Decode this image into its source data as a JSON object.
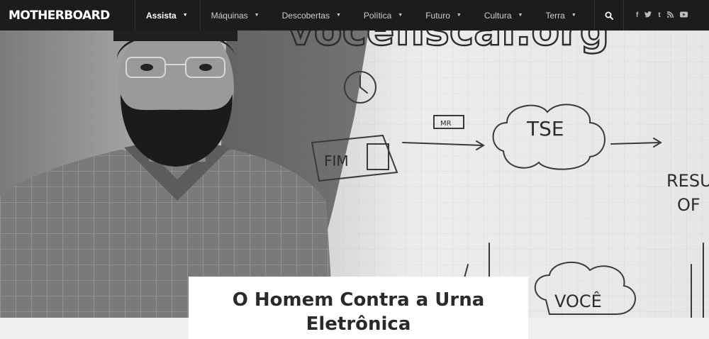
{
  "header": {
    "logo": "MOTHERBOARD",
    "nav": [
      {
        "label": "Assista",
        "active": true
      },
      {
        "label": "Máquinas"
      },
      {
        "label": "Descobertas"
      },
      {
        "label": "Política"
      },
      {
        "label": "Futuro"
      },
      {
        "label": "Cultura"
      },
      {
        "label": "Terra"
      }
    ],
    "caret": "▼",
    "icons": {
      "search": "search-icon",
      "social": [
        {
          "name": "facebook-icon",
          "glyph": "f"
        },
        {
          "name": "twitter-icon",
          "glyph": "t"
        },
        {
          "name": "tumblr-icon",
          "glyph": "t"
        },
        {
          "name": "rss-icon",
          "glyph": "rss"
        },
        {
          "name": "youtube-icon",
          "glyph": "▶"
        }
      ]
    }
  },
  "hero": {
    "whiteboard": {
      "url_text": "vocefiscal.org",
      "fim_label": "FIM",
      "chip_label": "MR",
      "tse_label": "TSE",
      "result_line1": "RESU",
      "result_line2": "OF",
      "voce_label": "VOCÊ"
    }
  },
  "article": {
    "title": "O Homem Contra a Urna Eletrônica"
  },
  "colors": {
    "nav_bg": "#1c1c1c",
    "nav_text": "#cfcfcf",
    "title_text": "#2a2a2a",
    "page_bg": "#efefef"
  }
}
